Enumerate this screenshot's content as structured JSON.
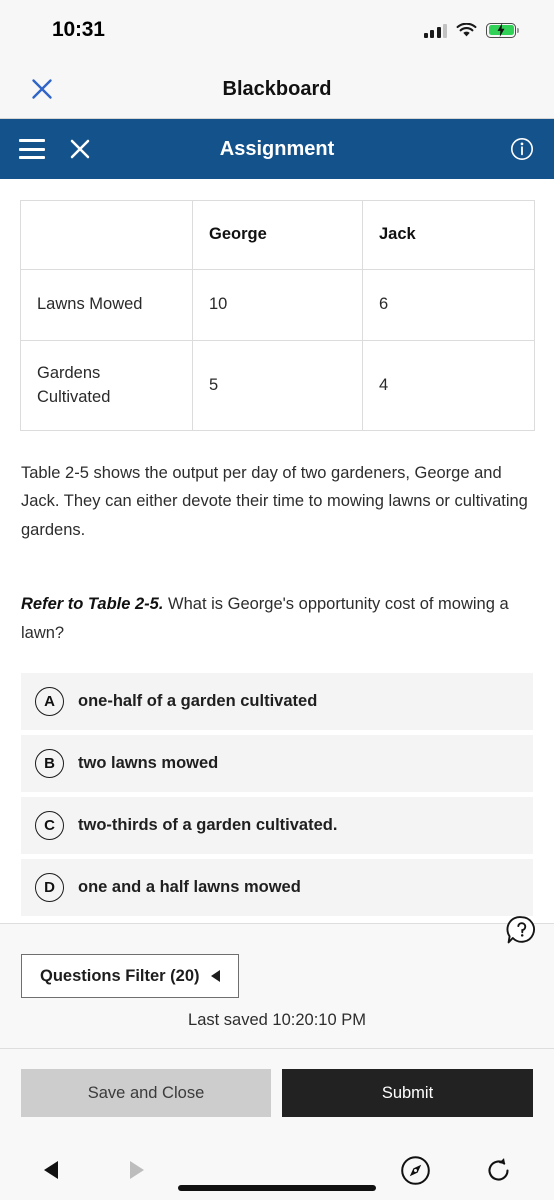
{
  "status_bar": {
    "time": "10:31",
    "signal_icon": "cellular-signal-icon",
    "wifi_icon": "wifi-icon",
    "battery_icon": "battery-charging-icon",
    "battery_color": "#31d158"
  },
  "page_bar": {
    "close_icon": "close-icon",
    "close_color": "#2f64c8",
    "title": "Blackboard"
  },
  "app_header": {
    "menu_icon": "hamburger-menu-icon",
    "close_icon": "close-icon",
    "title": "Assignment",
    "info_icon": "info-circle-icon",
    "background_color": "#14528c"
  },
  "question": {
    "table": {
      "headers": [
        "",
        "George",
        "Jack"
      ],
      "rows": [
        {
          "label": "Lawns Mowed",
          "george": "10",
          "jack": "6"
        },
        {
          "label": "Gardens Cultivated",
          "george": "5",
          "jack": "4"
        }
      ]
    },
    "intro_text": "Table 2-5 shows the output per day of two gardeners, George and Jack. They can either devote their time to mowing lawns or cultivating gardens.",
    "prompt_prefix": "Refer to Table 2-5.",
    "prompt_text": " What is George's opportunity cost of mowing a lawn?",
    "options": [
      {
        "letter": "A",
        "text": "one-half of a garden cultivated"
      },
      {
        "letter": "B",
        "text": "two lawns mowed"
      },
      {
        "letter": "C",
        "text": "two-thirds of a garden cultivated."
      },
      {
        "letter": "D",
        "text": "one and a half lawns mowed"
      }
    ]
  },
  "help": {
    "icon": "help-question-bubble-icon"
  },
  "filter_bar": {
    "button_label": "Questions Filter (20)",
    "caret_icon": "caret-left-icon",
    "last_saved": "Last saved 10:20:10 PM"
  },
  "actions": {
    "save_label": "Save and Close",
    "submit_label": "Submit",
    "submit_color": "#222222",
    "save_color": "#cdcdcd"
  },
  "browser_nav": {
    "back_icon": "nav-back-icon",
    "forward_icon": "nav-forward-icon",
    "home_indicator": "home-indicator-bar",
    "compass_icon": "safari-compass-icon",
    "reload_icon": "reload-icon"
  }
}
